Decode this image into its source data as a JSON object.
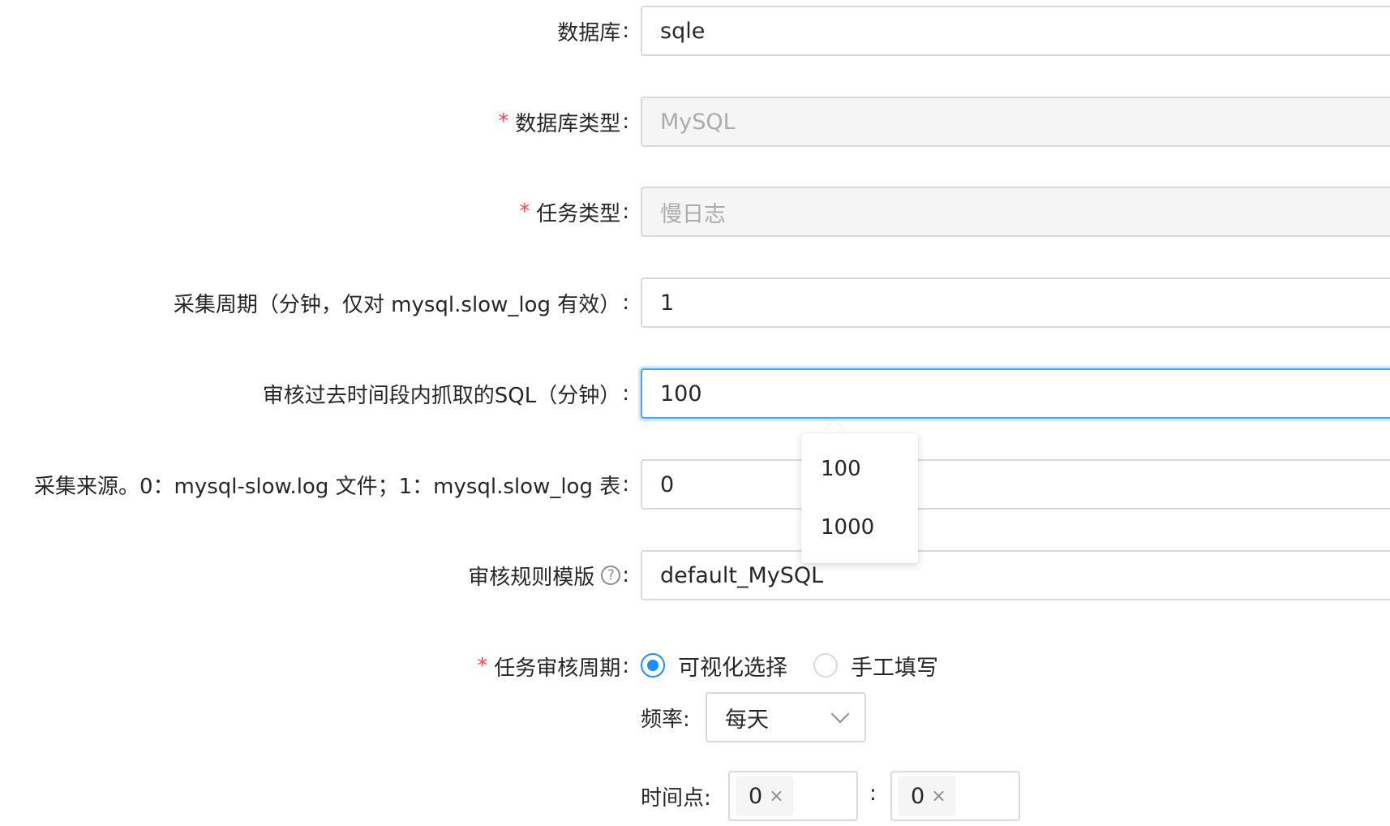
{
  "form": {
    "database": {
      "label": "数据库",
      "value": "sqle",
      "required": false
    },
    "db_type": {
      "label": "数据库类型",
      "value": "MySQL",
      "required": true,
      "disabled": true
    },
    "task_type": {
      "label": "任务类型",
      "value": "慢日志",
      "required": true,
      "disabled": true
    },
    "collect_period": {
      "label": "采集周期（分钟，仅对 mysql.slow_log 有效）",
      "value": "1"
    },
    "audit_window": {
      "label": "审核过去时间段内抓取的SQL（分钟）",
      "value": "100",
      "focused": true
    },
    "collect_source": {
      "label": "采集来源。0：mysql-slow.log 文件；1：mysql.slow_log 表",
      "value": "0"
    },
    "rule_template": {
      "label": "审核规则模版",
      "value": "default_MySQL",
      "help_icon": "question-circle-icon"
    },
    "audit_schedule": {
      "label": "任务审核周期",
      "required": true,
      "options": [
        {
          "label": "可视化选择",
          "checked": true
        },
        {
          "label": "手工填写",
          "checked": false
        }
      ],
      "frequency_label": "频率:",
      "frequency_value": "每天",
      "time_label": "时间点:",
      "time_separator": ":",
      "hour_tag": "0",
      "minute_tag": "0"
    }
  },
  "autocomplete": {
    "options": [
      "100",
      "1000"
    ]
  },
  "colon": ":",
  "required_mark": "*",
  "colors": {
    "primary": "#1890ff",
    "required": "#ff4d4f",
    "border": "#d9d9d9",
    "disabled_bg": "#f5f5f5"
  }
}
